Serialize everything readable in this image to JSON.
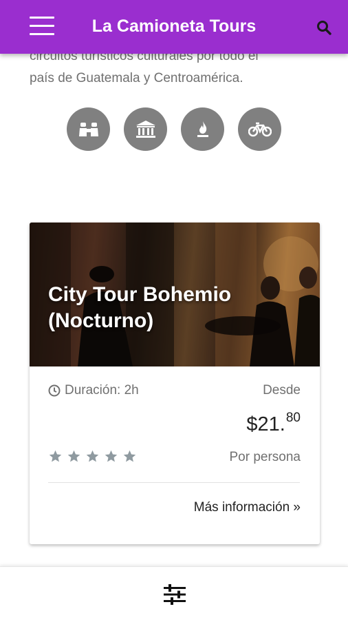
{
  "header": {
    "title": "La Camioneta Tours"
  },
  "intro": {
    "line1": "circuitos turísticos culturales por todo el",
    "line2": "país de Guatemala y Centroamérica."
  },
  "categories": [
    {
      "icon": "binoculars-icon"
    },
    {
      "icon": "museum-icon"
    },
    {
      "icon": "volcano-icon"
    },
    {
      "icon": "bicycle-icon"
    }
  ],
  "tour": {
    "title_line1": "City Tour Bohemio",
    "title_line2": "(Nocturno)",
    "duration": "Duración: 2h",
    "from_label": "Desde",
    "price_main": "$21.",
    "price_cents": "80",
    "per_person": "Por persona",
    "rating": 5,
    "more_info": "Más información »"
  },
  "colors": {
    "primary": "#9a2ecf",
    "icon_circle": "#808080",
    "muted_text": "#707070",
    "star": "#8f9aa0"
  }
}
